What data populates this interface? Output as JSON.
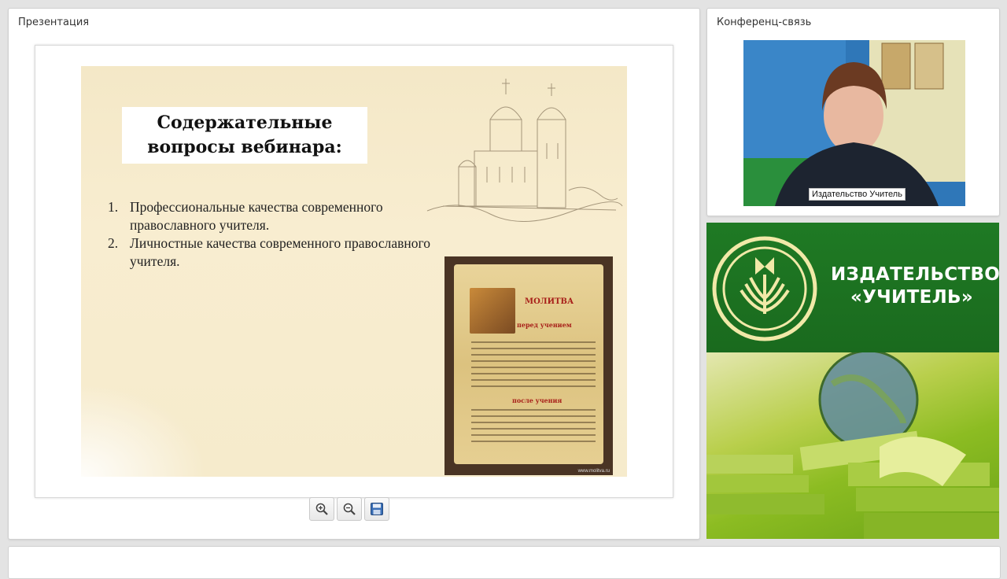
{
  "presentation_panel": {
    "title": "Презентация",
    "slide": {
      "title": "Содержательные\nвопросы вебинара:",
      "points": [
        {
          "num": "1.",
          "text": "Профессиональные качества современного православного учителя."
        },
        {
          "num": "2.",
          "text": "Личностные качества современного православного учителя."
        }
      ],
      "prayer_heading": "МОЛИТВА",
      "prayer_before": "перед учением",
      "prayer_after": "после учения",
      "prayer_source": "www.molitva.ru"
    },
    "toolbar": {
      "zoom_in_icon": "zoom-in-icon",
      "zoom_out_icon": "zoom-out-icon",
      "save_icon": "save-icon"
    }
  },
  "conference_panel": {
    "title": "Конференц-связь",
    "participant_name": "Издательство Учитель"
  },
  "brand_panel": {
    "name": "ИЗДАТЕЛЬСТВО\n«УЧИТЕЛЬ»",
    "colors": {
      "primary": "#1f7a24",
      "accent": "#8cbc22"
    }
  }
}
